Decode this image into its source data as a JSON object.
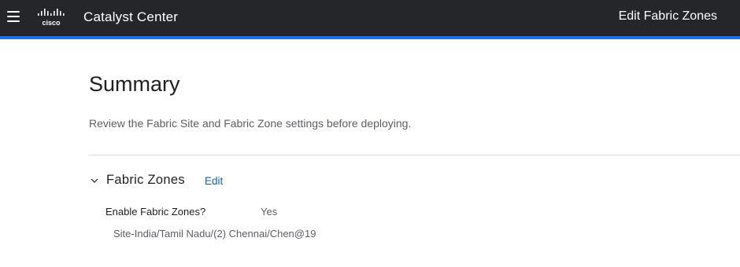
{
  "header": {
    "logo_text": "cisco",
    "app_title": "Catalyst Center",
    "page_context": "Edit Fabric Zones",
    "accent_color": "#1d72e6",
    "background_color": "#24262a"
  },
  "summary": {
    "title": "Summary",
    "description": "Review the Fabric Site and Fabric Zone settings before deploying."
  },
  "fabric_zones": {
    "section_title": "Fabric Zones",
    "edit_label": "Edit",
    "enable_label": "Enable Fabric Zones?",
    "enable_value": "Yes",
    "site_path": "Site-India/Tamil Nadu/(2) Chennai/Chen@19"
  },
  "icons": {
    "menu": "hamburger-menu-icon",
    "logo": "cisco-logo",
    "section_toggle": "chevron-down-icon"
  }
}
